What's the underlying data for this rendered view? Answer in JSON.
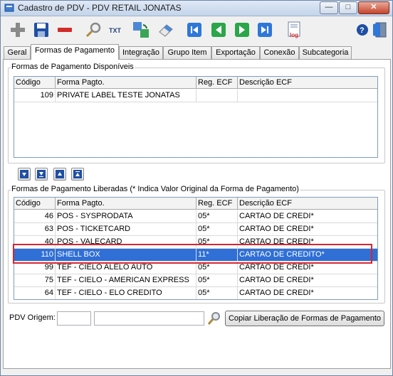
{
  "window": {
    "title": "Cadastro de PDV - PDV RETAIL JONATAS"
  },
  "titlebar_buttons": {
    "minimize": "—",
    "maximize": "□",
    "close": "✕"
  },
  "toolbar": {
    "icons": [
      "add-icon",
      "save-icon",
      "remove-icon",
      "search-icon",
      "txt-icon",
      "refresh-icon",
      "eraser-icon",
      "first-icon",
      "previous-icon",
      "next-icon",
      "last-icon",
      "log-icon",
      "help-icon",
      "exit-icon"
    ]
  },
  "tabs": [
    "Geral",
    "Formas de Pagamento",
    "Integração",
    "Grupo Item",
    "Exportação",
    "Conexão",
    "Subcategoria"
  ],
  "available": {
    "title": "Formas de Pagamento Disponíveis",
    "columns": [
      "Código",
      "Forma Pagto.",
      "Reg. ECF",
      "Descrição ECF"
    ],
    "rows": [
      [
        "109",
        "PRIVATE LABEL TESTE JONATAS",
        "",
        ""
      ]
    ]
  },
  "released": {
    "title": "Formas de Pagamento Liberadas (* Indica Valor Original da Forma de Pagamento)",
    "columns": [
      "Código",
      "Forma Pagto.",
      "Reg. ECF",
      "Descrição ECF"
    ],
    "rows": [
      [
        "46",
        "POS - SYSPRODATA",
        "05*",
        "CARTAO DE CREDI*"
      ],
      [
        "63",
        "POS - TICKETCARD",
        "05*",
        "CARTAO DE CREDI*"
      ],
      [
        "40",
        "POS - VALECARD",
        "05*",
        "CARTAO DE CREDI*"
      ],
      [
        "110",
        "SHELL BOX",
        "11*",
        "CARTAO DE CREDITO*"
      ],
      [
        "99",
        "TEF - CIELO ALELO AUTO",
        "05*",
        "CARTAO DE CREDI*"
      ],
      [
        "75",
        "TEF - CIELO - AMERICAN EXPRESS",
        "05*",
        "CARTAO DE CREDI*"
      ],
      [
        "64",
        "TEF - CIELO - ELO CREDITO",
        "05*",
        "CARTAO DE CREDI*"
      ]
    ],
    "selected_index": 3
  },
  "bottom": {
    "origem_label": "PDV Origem:",
    "origem_code": "",
    "origem_name": "",
    "copy_button": "Copiar Liberação de Formas de Pagamento"
  }
}
